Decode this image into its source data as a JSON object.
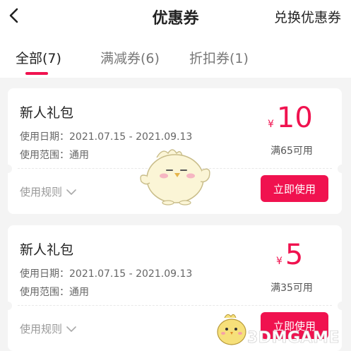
{
  "header": {
    "title": "优惠券",
    "action_label": "兑换优惠券",
    "back_icon": "back-icon"
  },
  "tabs": [
    {
      "label": "全部(7)",
      "active": true
    },
    {
      "label": "满减券(6)",
      "active": false
    },
    {
      "label": "折扣券(1)",
      "active": false
    }
  ],
  "coupons": [
    {
      "title": "新人礼包",
      "date_line": "使用日期：2021.07.15 - 2021.09.13",
      "scope_line": "使用范围：通用",
      "currency": "¥",
      "amount": "10",
      "condition": "满65可用",
      "rules_label": "使用规则",
      "use_label": "立即使用"
    },
    {
      "title": "新人礼包",
      "date_line": "使用日期：2021.07.15 - 2021.09.13",
      "scope_line": "使用范围：通用",
      "currency": "¥",
      "amount": "5",
      "condition": "满35可用",
      "rules_label": "使用规则",
      "use_label": "立即使用"
    }
  ],
  "watermark": "3DMGAME",
  "colors": {
    "accent": "#f0124f",
    "background": "#f4f4f4"
  }
}
